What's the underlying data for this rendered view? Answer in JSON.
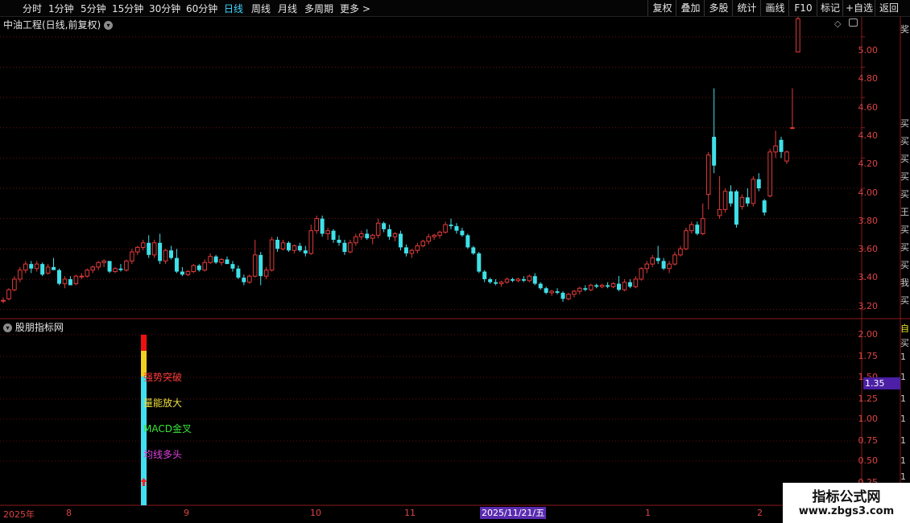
{
  "toolbar": {
    "periods": [
      "分时",
      "1分钟",
      "5分钟",
      "15分钟",
      "30分钟",
      "60分钟",
      "日线",
      "周线",
      "月线",
      "多周期",
      "更多 >"
    ],
    "active_period": "日线",
    "buttons": [
      "复权",
      "叠加",
      "多股",
      "统计",
      "画线",
      "F10",
      "标记",
      "+自选",
      "返回"
    ]
  },
  "main_chart": {
    "title": "中油工程(日线,前复权)",
    "y_ticks": [
      "5.00",
      "4.80",
      "4.60",
      "4.40",
      "4.20",
      "4.00",
      "3.80",
      "3.60",
      "3.40",
      "3.20"
    ],
    "right_edge_chars": [
      "奖",
      "买",
      "买",
      "买",
      "买",
      "买",
      "王",
      "买",
      "买",
      "买",
      "我",
      "买"
    ]
  },
  "sub_chart": {
    "title": "股朋指标网",
    "y_ticks": [
      "2.00",
      "1.75",
      "1.50",
      "1.25",
      "1.00",
      "0.75",
      "0.50",
      "0.25"
    ],
    "current_value": "1.35",
    "signals": {
      "strong_breakout": "强势突破",
      "volume_up": "量能放大",
      "macd_cross": "MACD金叉",
      "ma_bull": "均线多头"
    },
    "right_edge_chars": [
      "自",
      "买",
      "1",
      "1",
      "1",
      "1",
      "1",
      "1",
      "1",
      "1"
    ]
  },
  "x_axis": {
    "labels": [
      "2025年",
      "8",
      "9",
      "10",
      "11",
      "2025/11/21/五",
      "1",
      "2"
    ]
  },
  "watermark": {
    "line1": "指标公式网",
    "line2": "www.zbgs3.com"
  },
  "colors": {
    "up": "#e03b3b",
    "down": "#3fe0e8",
    "grid": "#5a1010",
    "axis_text": "#dd4444",
    "active_period": "#3cd6ff"
  },
  "chart_data": {
    "type": "candlestick",
    "ylim": [
      3.15,
      5.1
    ],
    "candles": [
      {
        "o": 3.26,
        "h": 3.28,
        "l": 3.24,
        "c": 3.26
      },
      {
        "o": 3.27,
        "h": 3.34,
        "l": 3.26,
        "c": 3.33
      },
      {
        "o": 3.33,
        "h": 3.42,
        "l": 3.32,
        "c": 3.4
      },
      {
        "o": 3.4,
        "h": 3.48,
        "l": 3.38,
        "c": 3.46
      },
      {
        "o": 3.46,
        "h": 3.52,
        "l": 3.44,
        "c": 3.5
      },
      {
        "o": 3.5,
        "h": 3.52,
        "l": 3.44,
        "c": 3.47
      },
      {
        "o": 3.47,
        "h": 3.52,
        "l": 3.45,
        "c": 3.5
      },
      {
        "o": 3.5,
        "h": 3.51,
        "l": 3.42,
        "c": 3.43
      },
      {
        "o": 3.44,
        "h": 3.5,
        "l": 3.43,
        "c": 3.48
      },
      {
        "o": 3.48,
        "h": 3.54,
        "l": 3.46,
        "c": 3.46
      },
      {
        "o": 3.46,
        "h": 3.47,
        "l": 3.36,
        "c": 3.37
      },
      {
        "o": 3.37,
        "h": 3.42,
        "l": 3.34,
        "c": 3.4
      },
      {
        "o": 3.4,
        "h": 3.42,
        "l": 3.36,
        "c": 3.36
      },
      {
        "o": 3.37,
        "h": 3.43,
        "l": 3.36,
        "c": 3.42
      },
      {
        "o": 3.42,
        "h": 3.44,
        "l": 3.4,
        "c": 3.42
      },
      {
        "o": 3.42,
        "h": 3.47,
        "l": 3.41,
        "c": 3.46
      },
      {
        "o": 3.46,
        "h": 3.49,
        "l": 3.44,
        "c": 3.48
      },
      {
        "o": 3.48,
        "h": 3.52,
        "l": 3.46,
        "c": 3.51
      },
      {
        "o": 3.51,
        "h": 3.53,
        "l": 3.48,
        "c": 3.52
      },
      {
        "o": 3.52,
        "h": 3.52,
        "l": 3.44,
        "c": 3.45
      },
      {
        "o": 3.45,
        "h": 3.48,
        "l": 3.44,
        "c": 3.47
      },
      {
        "o": 3.47,
        "h": 3.5,
        "l": 3.45,
        "c": 3.46
      },
      {
        "o": 3.46,
        "h": 3.53,
        "l": 3.45,
        "c": 3.52
      },
      {
        "o": 3.52,
        "h": 3.6,
        "l": 3.5,
        "c": 3.58
      },
      {
        "o": 3.58,
        "h": 3.62,
        "l": 3.56,
        "c": 3.61
      },
      {
        "o": 3.61,
        "h": 3.66,
        "l": 3.59,
        "c": 3.64
      },
      {
        "o": 3.64,
        "h": 3.69,
        "l": 3.54,
        "c": 3.56
      },
      {
        "o": 3.56,
        "h": 3.66,
        "l": 3.54,
        "c": 3.64
      },
      {
        "o": 3.64,
        "h": 3.7,
        "l": 3.5,
        "c": 3.52
      },
      {
        "o": 3.52,
        "h": 3.6,
        "l": 3.5,
        "c": 3.59
      },
      {
        "o": 3.59,
        "h": 3.62,
        "l": 3.53,
        "c": 3.54
      },
      {
        "o": 3.54,
        "h": 3.6,
        "l": 3.44,
        "c": 3.45
      },
      {
        "o": 3.45,
        "h": 3.48,
        "l": 3.42,
        "c": 3.43
      },
      {
        "o": 3.43,
        "h": 3.46,
        "l": 3.42,
        "c": 3.45
      },
      {
        "o": 3.45,
        "h": 3.5,
        "l": 3.44,
        "c": 3.49
      },
      {
        "o": 3.49,
        "h": 3.5,
        "l": 3.45,
        "c": 3.46
      },
      {
        "o": 3.46,
        "h": 3.53,
        "l": 3.45,
        "c": 3.51
      },
      {
        "o": 3.51,
        "h": 3.57,
        "l": 3.5,
        "c": 3.55
      },
      {
        "o": 3.55,
        "h": 3.56,
        "l": 3.5,
        "c": 3.51
      },
      {
        "o": 3.51,
        "h": 3.54,
        "l": 3.49,
        "c": 3.53
      },
      {
        "o": 3.53,
        "h": 3.55,
        "l": 3.5,
        "c": 3.5
      },
      {
        "o": 3.5,
        "h": 3.52,
        "l": 3.45,
        "c": 3.47
      },
      {
        "o": 3.47,
        "h": 3.49,
        "l": 3.4,
        "c": 3.41
      },
      {
        "o": 3.41,
        "h": 3.43,
        "l": 3.36,
        "c": 3.38
      },
      {
        "o": 3.38,
        "h": 3.43,
        "l": 3.37,
        "c": 3.42
      },
      {
        "o": 3.42,
        "h": 3.66,
        "l": 3.41,
        "c": 3.56
      },
      {
        "o": 3.56,
        "h": 3.58,
        "l": 3.36,
        "c": 3.42
      },
      {
        "o": 3.42,
        "h": 3.48,
        "l": 3.4,
        "c": 3.46
      },
      {
        "o": 3.46,
        "h": 3.68,
        "l": 3.45,
        "c": 3.66
      },
      {
        "o": 3.66,
        "h": 3.68,
        "l": 3.58,
        "c": 3.6
      },
      {
        "o": 3.6,
        "h": 3.66,
        "l": 3.59,
        "c": 3.64
      },
      {
        "o": 3.64,
        "h": 3.65,
        "l": 3.58,
        "c": 3.59
      },
      {
        "o": 3.59,
        "h": 3.63,
        "l": 3.57,
        "c": 3.62
      },
      {
        "o": 3.62,
        "h": 3.64,
        "l": 3.58,
        "c": 3.59
      },
      {
        "o": 3.59,
        "h": 3.62,
        "l": 3.55,
        "c": 3.57
      },
      {
        "o": 3.57,
        "h": 3.76,
        "l": 3.56,
        "c": 3.72
      },
      {
        "o": 3.72,
        "h": 3.82,
        "l": 3.7,
        "c": 3.8
      },
      {
        "o": 3.8,
        "h": 3.82,
        "l": 3.68,
        "c": 3.7
      },
      {
        "o": 3.7,
        "h": 3.74,
        "l": 3.66,
        "c": 3.72
      },
      {
        "o": 3.72,
        "h": 3.73,
        "l": 3.64,
        "c": 3.66
      },
      {
        "o": 3.66,
        "h": 3.69,
        "l": 3.62,
        "c": 3.64
      },
      {
        "o": 3.64,
        "h": 3.66,
        "l": 3.56,
        "c": 3.58
      },
      {
        "o": 3.58,
        "h": 3.66,
        "l": 3.57,
        "c": 3.64
      },
      {
        "o": 3.64,
        "h": 3.7,
        "l": 3.62,
        "c": 3.68
      },
      {
        "o": 3.68,
        "h": 3.72,
        "l": 3.66,
        "c": 3.7
      },
      {
        "o": 3.7,
        "h": 3.73,
        "l": 3.66,
        "c": 3.67
      },
      {
        "o": 3.67,
        "h": 3.7,
        "l": 3.63,
        "c": 3.69
      },
      {
        "o": 3.69,
        "h": 3.8,
        "l": 3.67,
        "c": 3.77
      },
      {
        "o": 3.77,
        "h": 3.78,
        "l": 3.71,
        "c": 3.73
      },
      {
        "o": 3.73,
        "h": 3.76,
        "l": 3.66,
        "c": 3.68
      },
      {
        "o": 3.68,
        "h": 3.71,
        "l": 3.65,
        "c": 3.7
      },
      {
        "o": 3.7,
        "h": 3.72,
        "l": 3.59,
        "c": 3.61
      },
      {
        "o": 3.61,
        "h": 3.63,
        "l": 3.55,
        "c": 3.57
      },
      {
        "o": 3.57,
        "h": 3.6,
        "l": 3.54,
        "c": 3.59
      },
      {
        "o": 3.59,
        "h": 3.64,
        "l": 3.57,
        "c": 3.62
      },
      {
        "o": 3.62,
        "h": 3.66,
        "l": 3.61,
        "c": 3.65
      },
      {
        "o": 3.65,
        "h": 3.7,
        "l": 3.63,
        "c": 3.68
      },
      {
        "o": 3.68,
        "h": 3.7,
        "l": 3.66,
        "c": 3.69
      },
      {
        "o": 3.69,
        "h": 3.72,
        "l": 3.67,
        "c": 3.71
      },
      {
        "o": 3.71,
        "h": 3.78,
        "l": 3.7,
        "c": 3.76
      },
      {
        "o": 3.76,
        "h": 3.8,
        "l": 3.73,
        "c": 3.75
      },
      {
        "o": 3.75,
        "h": 3.77,
        "l": 3.7,
        "c": 3.72
      },
      {
        "o": 3.72,
        "h": 3.74,
        "l": 3.68,
        "c": 3.69
      },
      {
        "o": 3.69,
        "h": 3.7,
        "l": 3.6,
        "c": 3.61
      },
      {
        "o": 3.61,
        "h": 3.62,
        "l": 3.56,
        "c": 3.57
      },
      {
        "o": 3.57,
        "h": 3.58,
        "l": 3.44,
        "c": 3.45
      },
      {
        "o": 3.45,
        "h": 3.46,
        "l": 3.38,
        "c": 3.4
      },
      {
        "o": 3.4,
        "h": 3.41,
        "l": 3.37,
        "c": 3.38
      },
      {
        "o": 3.38,
        "h": 3.4,
        "l": 3.36,
        "c": 3.37
      },
      {
        "o": 3.37,
        "h": 3.39,
        "l": 3.35,
        "c": 3.38
      },
      {
        "o": 3.38,
        "h": 3.41,
        "l": 3.37,
        "c": 3.4
      },
      {
        "o": 3.4,
        "h": 3.41,
        "l": 3.38,
        "c": 3.39
      },
      {
        "o": 3.39,
        "h": 3.41,
        "l": 3.38,
        "c": 3.4
      },
      {
        "o": 3.4,
        "h": 3.42,
        "l": 3.38,
        "c": 3.39
      },
      {
        "o": 3.39,
        "h": 3.43,
        "l": 3.38,
        "c": 3.42
      },
      {
        "o": 3.42,
        "h": 3.44,
        "l": 3.36,
        "c": 3.37
      },
      {
        "o": 3.37,
        "h": 3.38,
        "l": 3.33,
        "c": 3.34
      },
      {
        "o": 3.34,
        "h": 3.35,
        "l": 3.3,
        "c": 3.31
      },
      {
        "o": 3.31,
        "h": 3.33,
        "l": 3.29,
        "c": 3.32
      },
      {
        "o": 3.32,
        "h": 3.34,
        "l": 3.3,
        "c": 3.31
      },
      {
        "o": 3.31,
        "h": 3.32,
        "l": 3.25,
        "c": 3.27
      },
      {
        "o": 3.27,
        "h": 3.31,
        "l": 3.26,
        "c": 3.3
      },
      {
        "o": 3.3,
        "h": 3.33,
        "l": 3.28,
        "c": 3.32
      },
      {
        "o": 3.32,
        "h": 3.35,
        "l": 3.3,
        "c": 3.34
      },
      {
        "o": 3.34,
        "h": 3.36,
        "l": 3.32,
        "c": 3.33
      },
      {
        "o": 3.33,
        "h": 3.37,
        "l": 3.32,
        "c": 3.36
      },
      {
        "o": 3.36,
        "h": 3.37,
        "l": 3.34,
        "c": 3.35
      },
      {
        "o": 3.35,
        "h": 3.37,
        "l": 3.34,
        "c": 3.36
      },
      {
        "o": 3.36,
        "h": 3.38,
        "l": 3.34,
        "c": 3.35
      },
      {
        "o": 3.35,
        "h": 3.38,
        "l": 3.34,
        "c": 3.37
      },
      {
        "o": 3.37,
        "h": 3.42,
        "l": 3.32,
        "c": 3.33
      },
      {
        "o": 3.33,
        "h": 3.4,
        "l": 3.32,
        "c": 3.38
      },
      {
        "o": 3.38,
        "h": 3.4,
        "l": 3.34,
        "c": 3.35
      },
      {
        "o": 3.35,
        "h": 3.42,
        "l": 3.34,
        "c": 3.4
      },
      {
        "o": 3.4,
        "h": 3.48,
        "l": 3.39,
        "c": 3.47
      },
      {
        "o": 3.47,
        "h": 3.52,
        "l": 3.44,
        "c": 3.5
      },
      {
        "o": 3.5,
        "h": 3.56,
        "l": 3.48,
        "c": 3.54
      },
      {
        "o": 3.54,
        "h": 3.62,
        "l": 3.5,
        "c": 3.52
      },
      {
        "o": 3.52,
        "h": 3.54,
        "l": 3.46,
        "c": 3.47
      },
      {
        "o": 3.47,
        "h": 3.52,
        "l": 3.44,
        "c": 3.5
      },
      {
        "o": 3.5,
        "h": 3.58,
        "l": 3.49,
        "c": 3.56
      },
      {
        "o": 3.56,
        "h": 3.62,
        "l": 3.55,
        "c": 3.6
      },
      {
        "o": 3.6,
        "h": 3.74,
        "l": 3.59,
        "c": 3.72
      },
      {
        "o": 3.72,
        "h": 3.78,
        "l": 3.7,
        "c": 3.76
      },
      {
        "o": 3.76,
        "h": 3.78,
        "l": 3.69,
        "c": 3.7
      },
      {
        "o": 3.7,
        "h": 3.9,
        "l": 3.69,
        "c": 3.8
      },
      {
        "o": 3.96,
        "h": 4.24,
        "l": 3.86,
        "c": 4.22
      },
      {
        "o": 4.34,
        "h": 4.66,
        "l": 4.1,
        "c": 4.15
      },
      {
        "o": 3.82,
        "h": 4.08,
        "l": 3.8,
        "c": 3.86
      },
      {
        "o": 3.86,
        "h": 4.0,
        "l": 3.84,
        "c": 3.98
      },
      {
        "o": 3.98,
        "h": 4.02,
        "l": 3.88,
        "c": 3.9
      },
      {
        "o": 3.98,
        "h": 3.99,
        "l": 3.74,
        "c": 3.76
      },
      {
        "o": 3.88,
        "h": 3.96,
        "l": 3.86,
        "c": 3.94
      },
      {
        "o": 3.94,
        "h": 4.0,
        "l": 3.88,
        "c": 3.9
      },
      {
        "o": 3.9,
        "h": 4.08,
        "l": 3.88,
        "c": 4.06
      },
      {
        "o": 4.06,
        "h": 4.1,
        "l": 3.98,
        "c": 4.0
      },
      {
        "o": 3.92,
        "h": 3.93,
        "l": 3.82,
        "c": 3.84
      },
      {
        "o": 3.95,
        "h": 4.26,
        "l": 3.94,
        "c": 4.24
      },
      {
        "o": 4.24,
        "h": 4.38,
        "l": 4.2,
        "c": 4.28
      },
      {
        "o": 4.32,
        "h": 4.34,
        "l": 4.2,
        "c": 4.24
      },
      {
        "o": 4.18,
        "h": 4.25,
        "l": 4.16,
        "c": 4.24
      },
      {
        "o": 4.4,
        "h": 4.66,
        "l": 4.4,
        "c": 4.4
      },
      {
        "o": 4.9,
        "h": 5.14,
        "l": 4.9,
        "c": 5.12
      }
    ],
    "y_ticks": [
      5.0,
      4.8,
      4.6,
      4.4,
      4.2,
      4.0,
      3.8,
      3.6,
      3.4,
      3.2
    ]
  }
}
